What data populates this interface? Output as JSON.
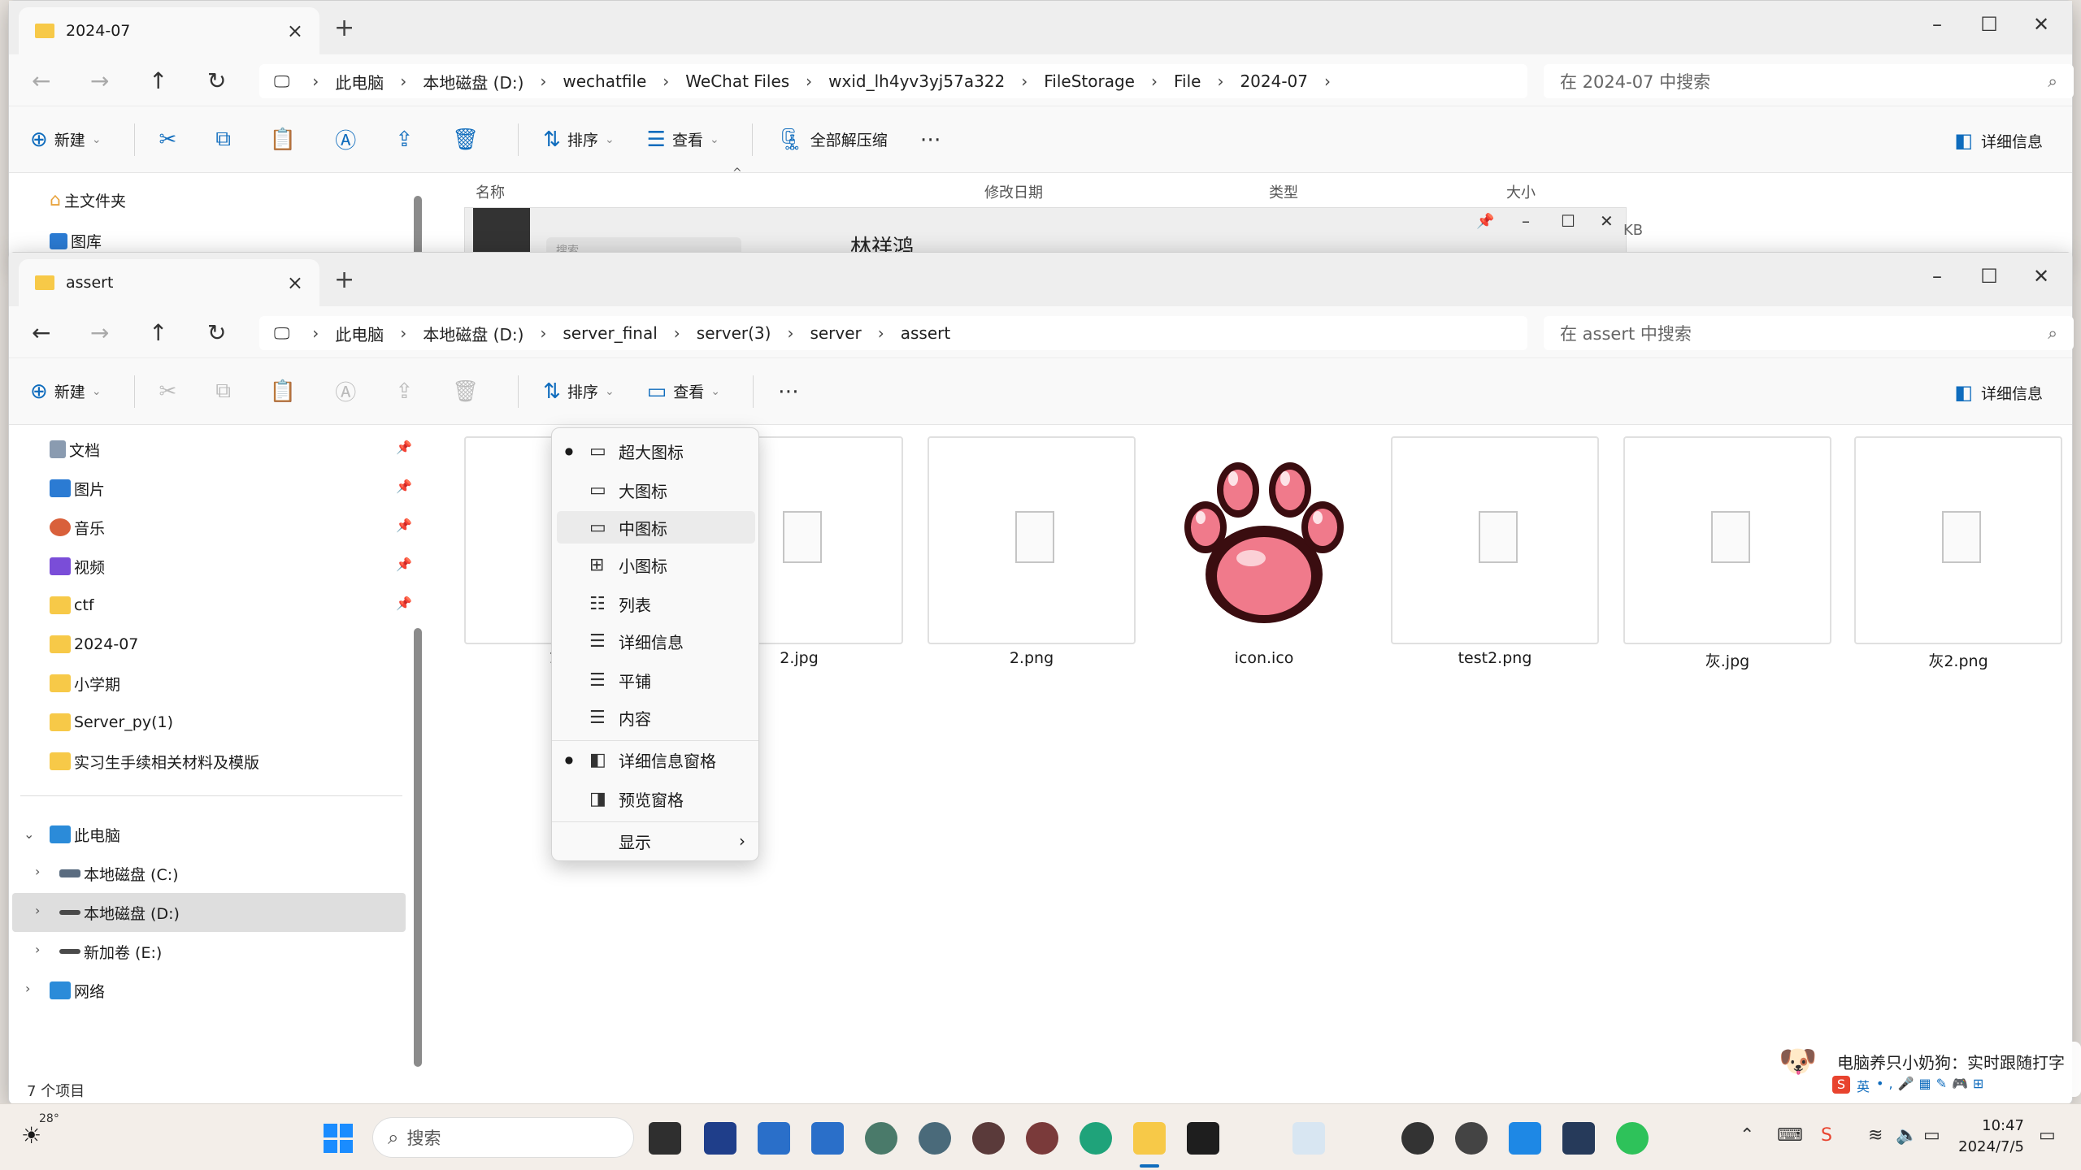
{
  "back_window": {
    "tab_title": "2024-07",
    "breadcrumb": [
      "此电脑",
      "本地磁盘 (D:)",
      "wechatfile",
      "WeChat Files",
      "wxid_lh4yv3yj57a322",
      "FileStorage",
      "File",
      "2024-07"
    ],
    "search_placeholder": "在 2024-07 中搜索",
    "toolbar": {
      "new": "新建",
      "sort": "排序",
      "view": "查看",
      "extract_all": "全部解压缩",
      "details": "详细信息"
    },
    "sidebar": {
      "home": "主文件夹",
      "gallery": "图库"
    },
    "columns": [
      "名称",
      "修改日期",
      "类型",
      "大小"
    ],
    "overlay_name": "林祥鸿",
    "overlay_search": "搜索",
    "size_fragment": "KB"
  },
  "front_window": {
    "tab_title": "assert",
    "breadcrumb": [
      "此电脑",
      "本地磁盘 (D:)",
      "server_final",
      "server(3)",
      "server",
      "assert"
    ],
    "search_placeholder": "在 assert 中搜索",
    "toolbar": {
      "new": "新建",
      "sort": "排序",
      "view": "查看",
      "details": "详细信息"
    },
    "sidebar": {
      "quick": [
        {
          "label": "文档",
          "icon": "document-icon"
        },
        {
          "label": "图片",
          "icon": "pictures-icon"
        },
        {
          "label": "音乐",
          "icon": "music-icon"
        },
        {
          "label": "视频",
          "icon": "video-icon"
        },
        {
          "label": "ctf",
          "icon": "folder-icon"
        },
        {
          "label": "2024-07",
          "icon": "folder-icon"
        },
        {
          "label": "小学期",
          "icon": "folder-icon"
        },
        {
          "label": "Server_py(1)",
          "icon": "folder-icon"
        },
        {
          "label": "实习生手续相关材料及模版",
          "icon": "folder-icon"
        }
      ],
      "this_pc": "此电脑",
      "drives": [
        "本地磁盘 (C:)",
        "本地磁盘 (D:)",
        "新加卷 (E:)"
      ],
      "network": "网络"
    },
    "files": [
      "1.jpg",
      "2.jpg",
      "2.png",
      "icon.ico",
      "test2.png",
      "灰.jpg",
      "灰2.png"
    ],
    "status": "7 个项目"
  },
  "view_menu": {
    "items": [
      {
        "label": "超大图标",
        "checked": true
      },
      {
        "label": "大图标",
        "checked": false
      },
      {
        "label": "中图标",
        "checked": false
      },
      {
        "label": "小图标",
        "checked": false
      },
      {
        "label": "列表",
        "checked": false
      },
      {
        "label": "详细信息",
        "checked": false
      },
      {
        "label": "平铺",
        "checked": false
      },
      {
        "label": "内容",
        "checked": false
      }
    ],
    "panes": [
      {
        "label": "详细信息窗格",
        "checked": true
      },
      {
        "label": "预览窗格",
        "checked": false
      }
    ],
    "show": "显示"
  },
  "ime_popup": {
    "text": "电脑养只小奶狗：实时跟随打字",
    "mode": "英"
  },
  "taskbar": {
    "weather": "28°",
    "search": "搜索",
    "time": "10:47",
    "date": "2024/7/5"
  },
  "colors": {
    "accent": "#0f6cbd",
    "folder": "#f7c948",
    "selected": "#dedede"
  }
}
